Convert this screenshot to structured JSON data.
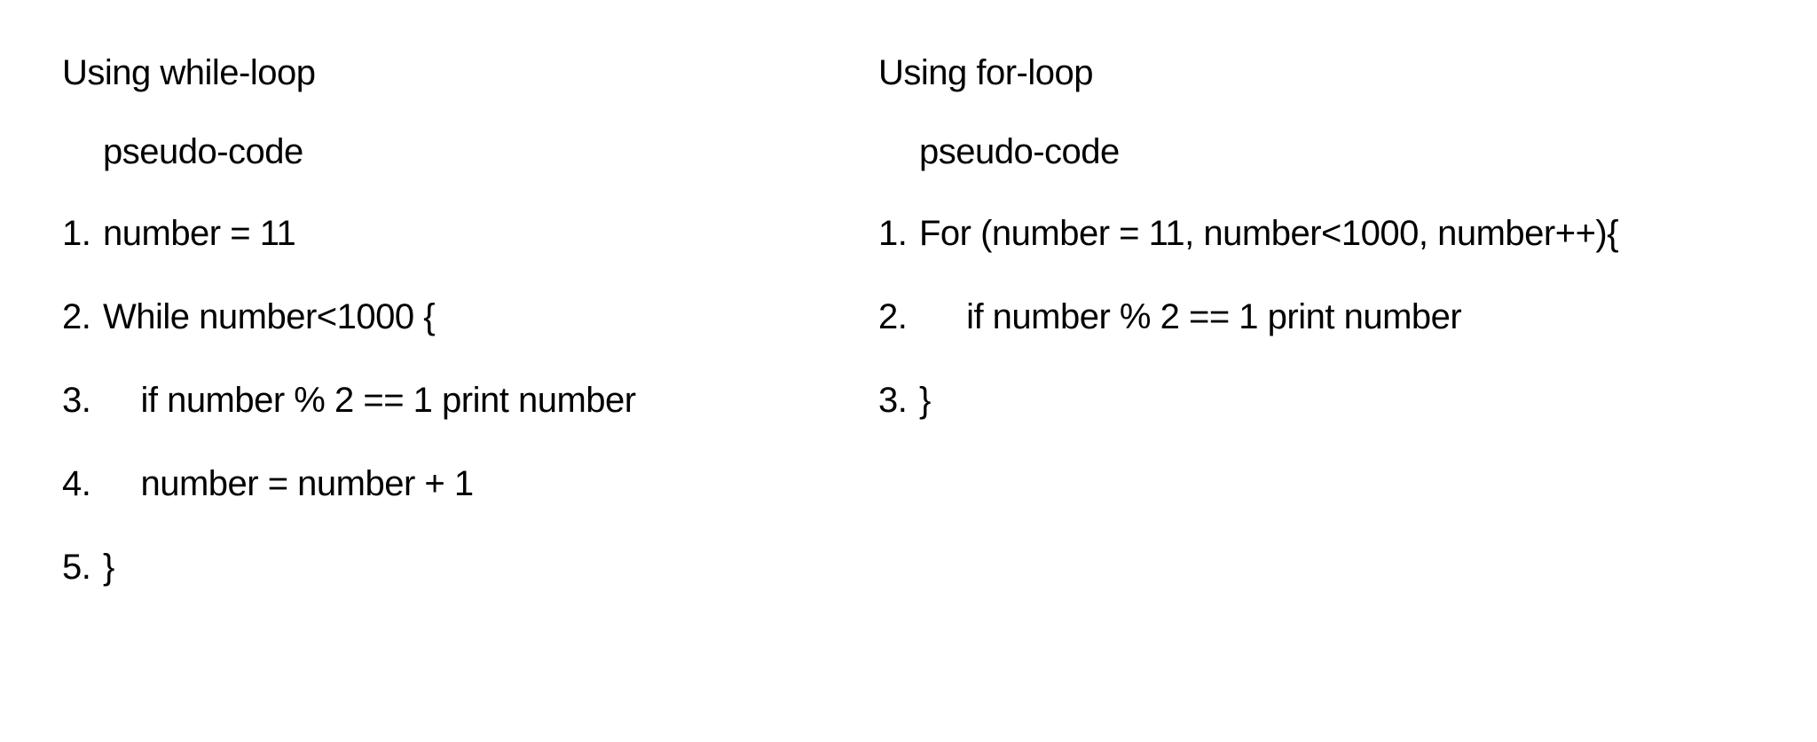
{
  "left": {
    "heading": "Using while-loop",
    "subheading": "pseudo-code",
    "items": [
      "number = 11",
      "While number<1000 {",
      "    if number % 2 == 1 print number",
      "    number = number + 1",
      "}"
    ]
  },
  "right": {
    "heading": "Using for-loop",
    "subheading": "pseudo-code",
    "items": [
      "For (number = 11, number<1000, number++){",
      "     if number % 2 == 1 print number",
      "}"
    ]
  }
}
